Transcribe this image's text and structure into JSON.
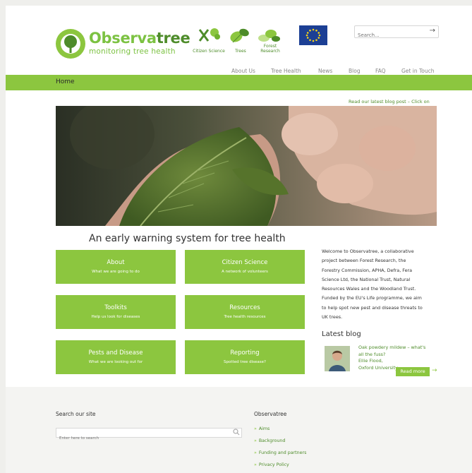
{
  "header": {
    "logo": {
      "name_light": "Observa",
      "name_bold": "tree",
      "tagline": "monitoring tree health"
    },
    "partner_labels": [
      "Citizen Science",
      "Trees",
      "Forest Research"
    ],
    "search_placeholder": "Search..."
  },
  "nav": {
    "items": [
      "About Us",
      "Tree Health",
      "News",
      "Blog",
      "FAQ",
      "Get in Touch"
    ]
  },
  "breadcrumb": "Home",
  "blog_banner_link": "Read our latest blog post – Click on",
  "hero_alt": "Hand holding a leaf",
  "tagline": "An early warning system for tree health",
  "tiles": [
    {
      "title": "About",
      "subtitle": "What we are going to do"
    },
    {
      "title": "Citizen Science",
      "subtitle": "A network of volunteers"
    },
    {
      "title": "Toolkits",
      "subtitle": "Help us look for diseases"
    },
    {
      "title": "Resources",
      "subtitle": "Tree health resources"
    },
    {
      "title": "Pests and Disease",
      "subtitle": "What we are looking out for"
    },
    {
      "title": "Reporting",
      "subtitle": "Spotted tree disease?"
    }
  ],
  "welcome_lines": [
    "Welcome to Observatree, a collaborative",
    "project between Forest Research, the",
    "Forestry Commission, APHA, Defra, Fera",
    "Science Ltd, the National Trust, Natural",
    "Resources Wales and the Woodland Trust.",
    "Funded by the EU's Life programme, we aim",
    "to help spot new pest and disease threats to",
    "UK trees."
  ],
  "latest_blog": {
    "heading": "Latest blog",
    "title_lines": [
      "Oak powdery mildew – what's",
      "all the fuss?"
    ],
    "author_lines": [
      "Ellie Flood,",
      "Oxford University"
    ],
    "read_more": "Read more",
    "read_more_arrow": "→"
  },
  "footer": {
    "search_heading": "Search our site",
    "search_placeholder": "Enter here to search",
    "links_heading": "Observatree",
    "links": [
      "Aims",
      "Background",
      "Funding and partners",
      "Privacy Policy"
    ]
  },
  "colors": {
    "brand_green": "#8cc63f",
    "dark_green": "#4e8c2a",
    "eu_blue": "#1c3f94"
  }
}
